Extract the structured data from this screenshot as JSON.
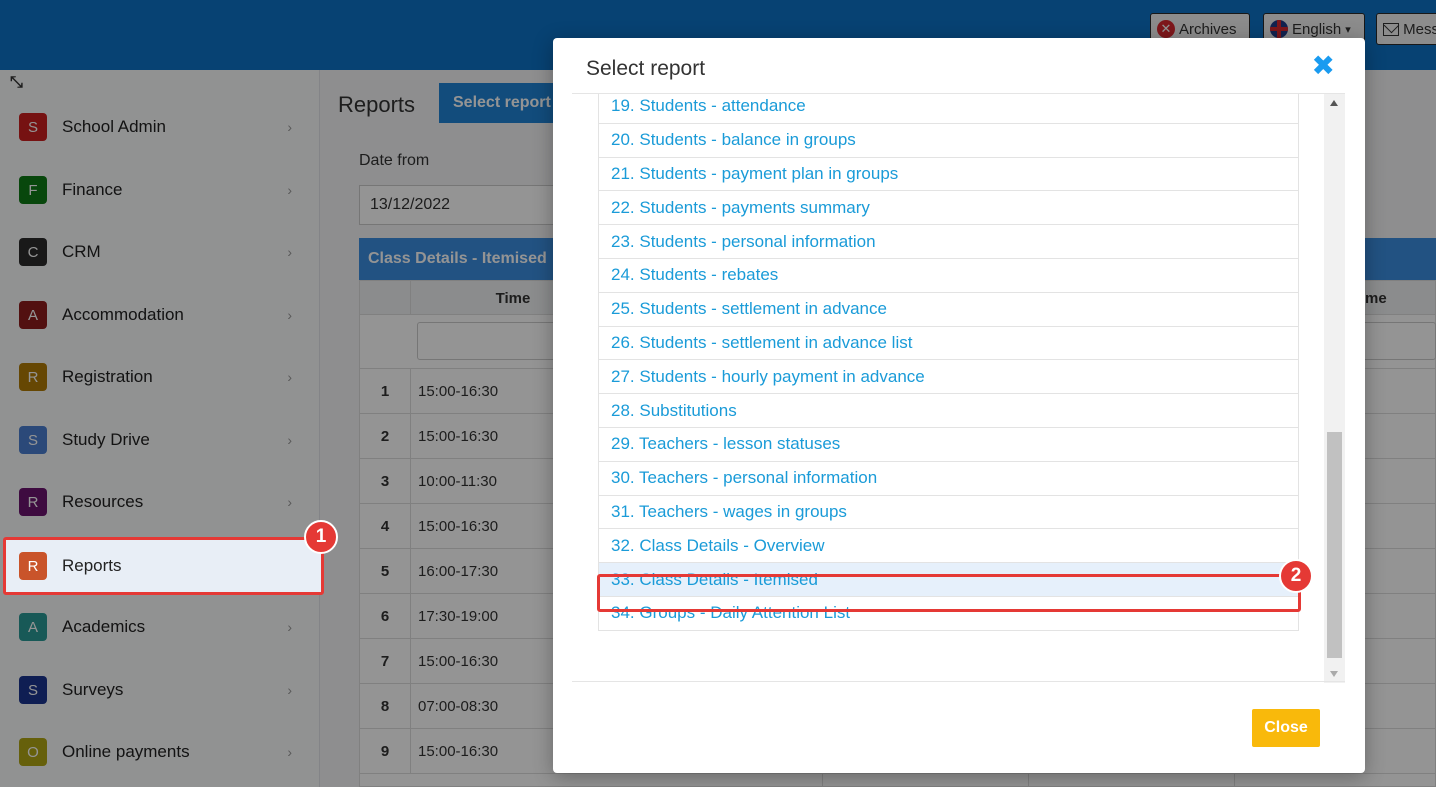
{
  "topbar": {
    "archives_label": "Archives",
    "language_label": "English",
    "messages_label": "Mess"
  },
  "sidebar": {
    "items": [
      {
        "letter": "S",
        "label": "School Admin",
        "color": "#cc1f1f"
      },
      {
        "letter": "F",
        "label": "Finance",
        "color": "#0f7a16"
      },
      {
        "letter": "C",
        "label": "CRM",
        "color": "#2b2b2b"
      },
      {
        "letter": "A",
        "label": "Accommodation",
        "color": "#8e1c1c"
      },
      {
        "letter": "R",
        "label": "Registration",
        "color": "#b07b06"
      },
      {
        "letter": "S",
        "label": "Study Drive",
        "color": "#4a7fd0"
      },
      {
        "letter": "R",
        "label": "Resources",
        "color": "#6b136f"
      },
      {
        "letter": "R",
        "label": "Reports",
        "color": "#c9542a"
      },
      {
        "letter": "A",
        "label": "Academics",
        "color": "#2a9a96"
      },
      {
        "letter": "S",
        "label": "Surveys",
        "color": "#1a3590"
      },
      {
        "letter": "O",
        "label": "Online payments",
        "color": "#b0a614"
      }
    ]
  },
  "main": {
    "title": "Reports",
    "select_report_label": "Select report",
    "date_from_label": "Date from",
    "date_from_value": "13/12/2022",
    "grid_title": "Class Details - Itemised",
    "col_time": "Time",
    "col_name_partial": "me",
    "rows": [
      {
        "idx": "1",
        "time": "15:00-16:30"
      },
      {
        "idx": "2",
        "time": "15:00-16:30"
      },
      {
        "idx": "3",
        "time": "10:00-11:30"
      },
      {
        "idx": "4",
        "time": "15:00-16:30"
      },
      {
        "idx": "5",
        "time": "16:00-17:30"
      },
      {
        "idx": "6",
        "time": "17:30-19:00"
      },
      {
        "idx": "7",
        "time": "15:00-16:30"
      },
      {
        "idx": "8",
        "time": "07:00-08:30"
      },
      {
        "idx": "9",
        "time": "15:00-16:30"
      }
    ]
  },
  "modal": {
    "title": "Select report",
    "close_label": "Close",
    "reports": [
      "19. Students - attendance",
      "20. Students - balance in groups",
      "21. Students - payment plan in groups",
      "22. Students - payments summary",
      "23. Students - personal information",
      "24. Students - rebates",
      "25. Students - settlement in advance",
      "26. Students - settlement in advance list",
      "27. Students - hourly payment in advance",
      "28. Substitutions",
      "29. Teachers - lesson statuses",
      "30. Teachers - personal information",
      "31. Teachers - wages in groups",
      "32. Class Details - Overview",
      "33. Class Details - Itemised",
      "34. Groups - Daily Attention List"
    ],
    "selected_index": 14
  },
  "annotations": {
    "step1": "1",
    "step2": "2"
  }
}
